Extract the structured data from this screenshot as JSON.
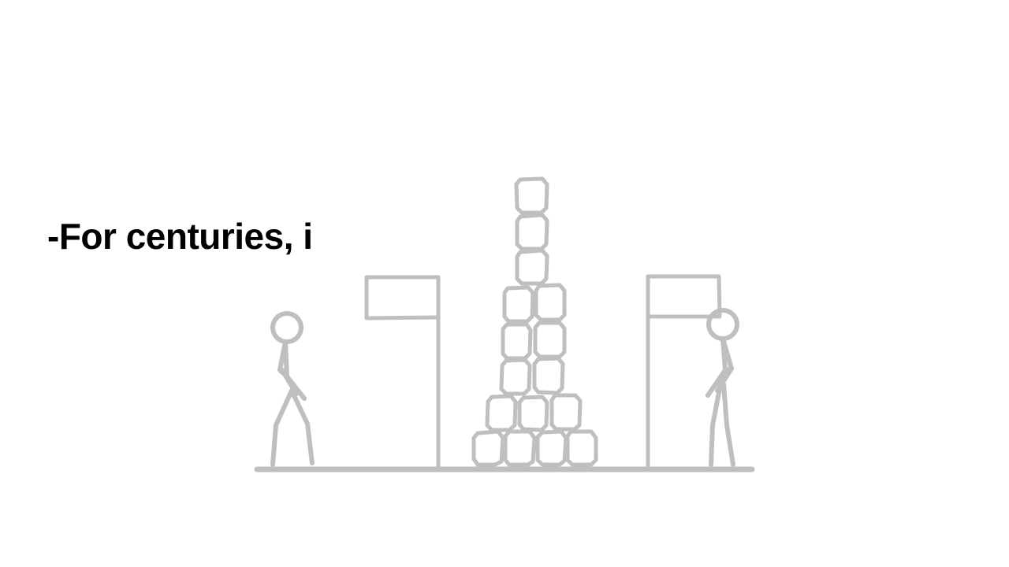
{
  "slide": {
    "caption": "-For centuries, i"
  },
  "colors": {
    "background": "#ffffff",
    "text": "#000000",
    "drawing": "#bfbfbf"
  }
}
